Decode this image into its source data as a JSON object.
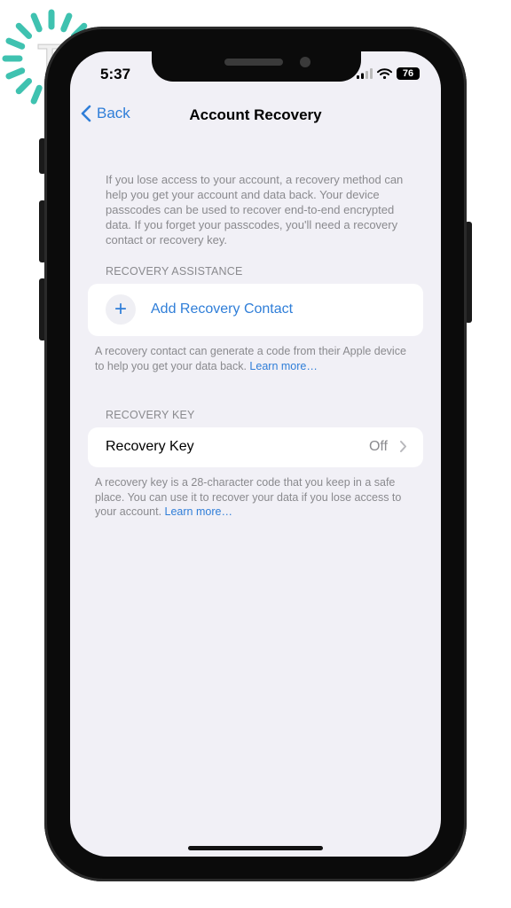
{
  "status_bar": {
    "time": "5:37",
    "battery": "76",
    "icons": [
      "signal-icon",
      "wifi-icon",
      "battery-icon"
    ]
  },
  "nav": {
    "back_label": "Back",
    "title": "Account Recovery"
  },
  "intro_text": "If you lose access to your account, a recovery method can help you get your account and data back. Your device passcodes can be used to recover end-to-end encrypted data. If you forget your passcodes, you'll need a recovery contact or recovery key.",
  "recovery_assistance": {
    "header": "RECOVERY ASSISTANCE",
    "add_contact_label": "Add Recovery Contact",
    "footnote": "A recovery contact can generate a code from their Apple device to help you get your data back. ",
    "learn_more": "Learn more…"
  },
  "recovery_key": {
    "header": "RECOVERY KEY",
    "label": "Recovery Key",
    "value": "Off",
    "footnote": "A recovery key is a 28-character code that you keep in a safe place. You can use it to recover your data if you lose access to your account. ",
    "learn_more": "Learn more…"
  },
  "colors": {
    "accent": "#2f7ed8",
    "background": "#f1f0f6",
    "secondary_text": "#8a8a8e",
    "logo_teal": "#3fc2b0"
  }
}
